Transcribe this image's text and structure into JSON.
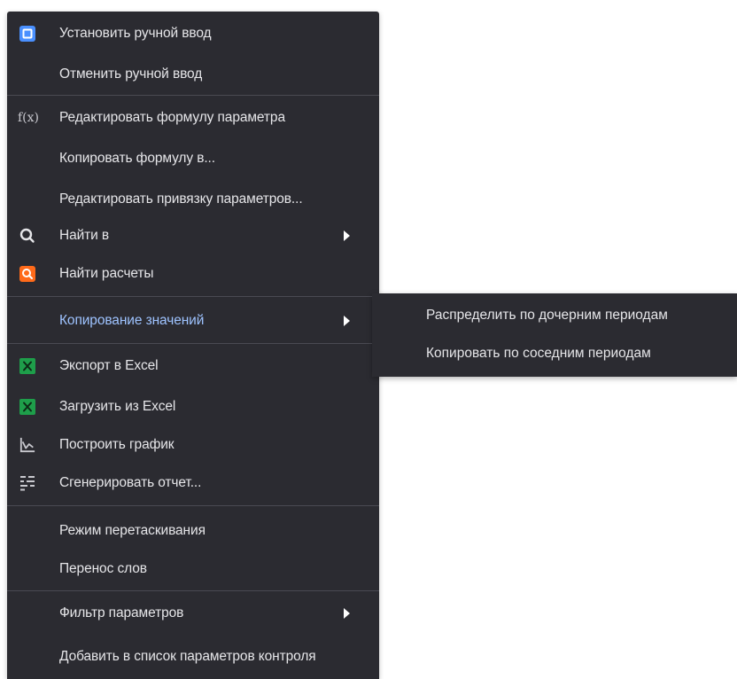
{
  "menu": {
    "items": [
      {
        "label": "Установить ручной ввод",
        "icon": "manual-input-icon",
        "color": "#4a90ff"
      },
      {
        "label": "Отменить ручной ввод"
      },
      {
        "label": "Редактировать формулу параметра",
        "icon_text": "f(x)"
      },
      {
        "label": "Копировать формулу в..."
      },
      {
        "label": "Редактировать привязку параметров..."
      },
      {
        "label": "Найти в",
        "icon": "search-icon"
      },
      {
        "label": "Найти расчеты",
        "icon": "search-calc-icon",
        "color": "#ff6a1a"
      },
      {
        "label": "Копирование значений",
        "highlight_color": "#9ec3ff"
      },
      {
        "label": "Экспорт в Excel",
        "icon": "excel-icon",
        "color": "#1e9e4a"
      },
      {
        "label": "Загрузить из Excel",
        "icon": "excel-icon",
        "color": "#1e9e4a"
      },
      {
        "label": "Построить график",
        "icon": "chart-icon"
      },
      {
        "label": "Сгенерировать отчет...",
        "icon": "report-icon"
      },
      {
        "label": "Режим перетаскивания"
      },
      {
        "label": "Перенос слов"
      },
      {
        "label": "Фильтр параметров"
      },
      {
        "label": "Добавить в список параметров контроля"
      }
    ]
  },
  "submenu": {
    "items": [
      {
        "label": "Распределить по дочерним периодам"
      },
      {
        "label": "Копировать по соседним периодам"
      }
    ]
  }
}
